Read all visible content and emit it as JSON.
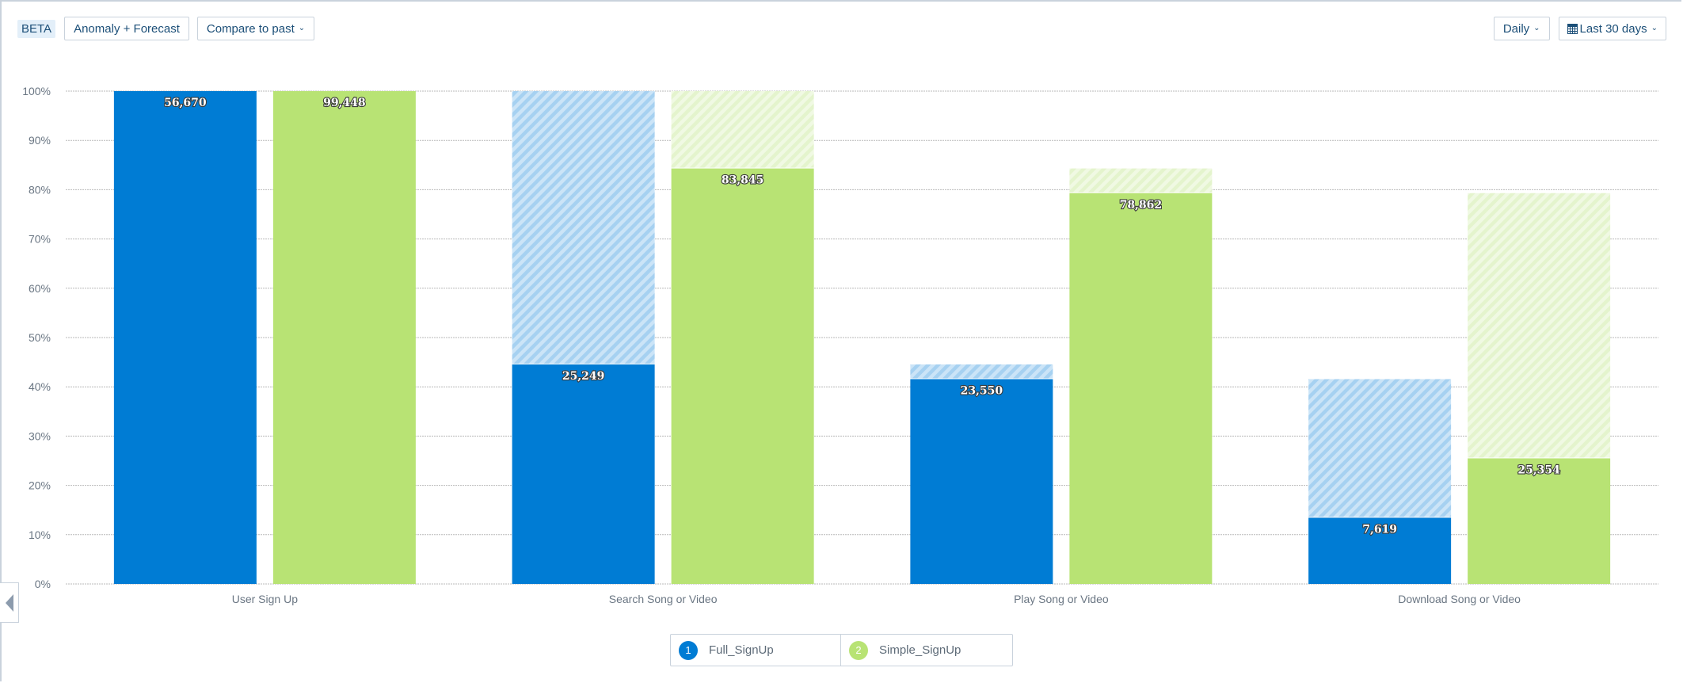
{
  "toolbar": {
    "beta_badge": "BETA",
    "anomaly_button": "Anomaly + Forecast",
    "compare_button": "Compare to past",
    "interval_button": "Daily",
    "date_range_button": "Last 30 days",
    "icons": {
      "chevron": "chevron-down-icon",
      "calendar": "calendar-icon"
    }
  },
  "colors": {
    "full_signup": "#007cd4",
    "full_signup_hatch_a": "#a6d1f1",
    "full_signup_hatch_b": "#cbe4f7",
    "simple_signup": "#b8e374",
    "simple_signup_hatch_a": "#e4f4cd",
    "simple_signup_hatch_b": "#f0f9e3",
    "grid": "#b9b9b9",
    "axis_text": "#6a7683"
  },
  "chart_data": {
    "type": "bar",
    "subtype": "funnel-grouped",
    "title": "",
    "xlabel": "",
    "ylabel": "",
    "ylim": [
      0,
      100
    ],
    "yticks": [
      "0%",
      "10%",
      "20%",
      "30%",
      "40%",
      "50%",
      "60%",
      "70%",
      "80%",
      "90%",
      "100%"
    ],
    "grid": true,
    "legend_position": "bottom-center",
    "categories": [
      "User Sign Up",
      "Search Song or Video",
      "Play Song or Video",
      "Download Song or Video"
    ],
    "series": [
      {
        "name": "Full_SignUp",
        "index": "1",
        "counts": [
          56670,
          25249,
          23550,
          7619
        ],
        "count_labels": [
          "56,670",
          "25,249",
          "23,550",
          "7,619"
        ],
        "percent_of_first": [
          100,
          44.55,
          41.56,
          13.44
        ],
        "dropoff_from_previous_percent": [
          null,
          100,
          44.55,
          41.56
        ]
      },
      {
        "name": "Simple_SignUp",
        "index": "2",
        "counts": [
          99448,
          83845,
          78862,
          25354
        ],
        "count_labels": [
          "99,448",
          "83,845",
          "78,862",
          "25,354"
        ],
        "percent_of_first": [
          100,
          84.31,
          79.3,
          25.49
        ],
        "dropoff_from_previous_percent": [
          null,
          100,
          84.31,
          79.3
        ]
      }
    ]
  },
  "legend": [
    {
      "index": "1",
      "label": "Full_SignUp"
    },
    {
      "index": "2",
      "label": "Simple_SignUp"
    }
  ],
  "collapse_tab": {
    "icon": "caret-left-icon"
  }
}
